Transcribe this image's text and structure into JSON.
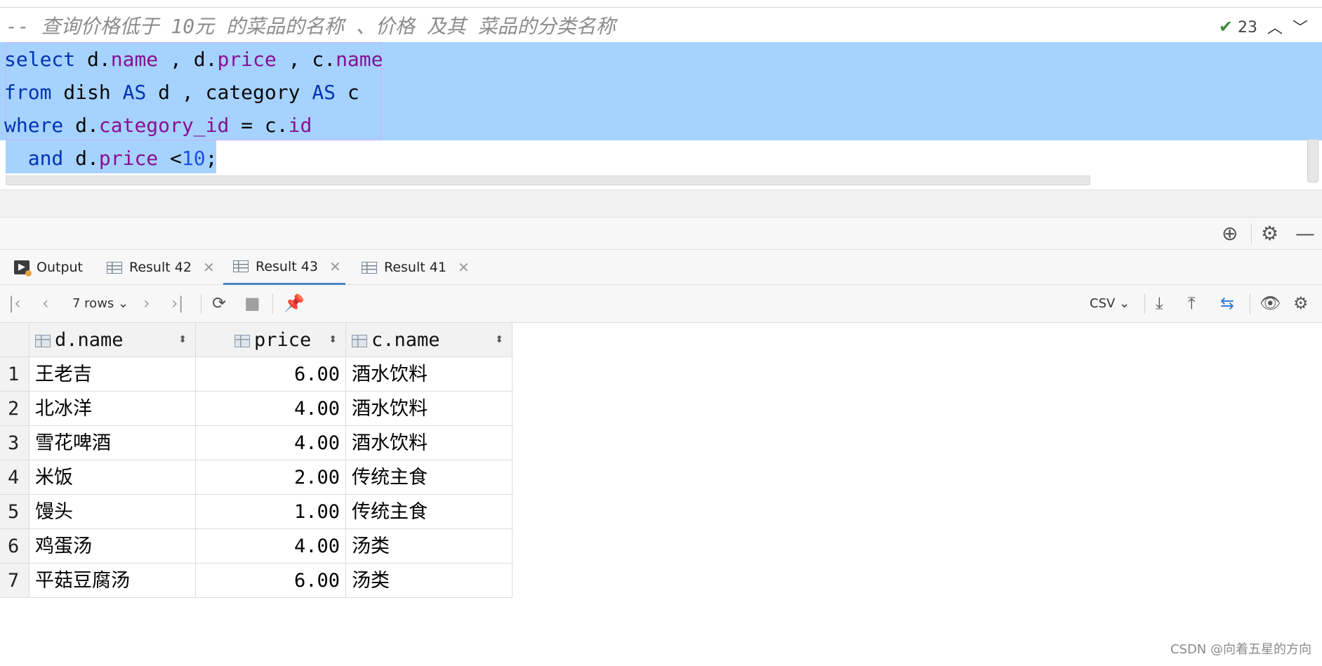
{
  "editor": {
    "comment": "-- 查询价格低于 10元 的菜品的名称 、价格 及其 菜品的分类名称",
    "inspection_count": "23",
    "line1": {
      "t1": "select",
      "t2": " d.",
      "t3": "name",
      "t4": " , d.",
      "t5": "price",
      "t6": " , c.",
      "t7": "name"
    },
    "line2": {
      "t1": "from",
      "t2": " dish ",
      "t3": "AS",
      "t4": " d , category ",
      "t5": "AS",
      "t6": " c"
    },
    "line3": {
      "t1": "where",
      "t2": " d.",
      "t3": "category_id",
      "t4": " = c.",
      "t5": "id"
    },
    "line4": {
      "t1": "  and",
      "t2": " d.",
      "t3": "price",
      "t4": " <",
      "t5": "10",
      "t6": ";"
    }
  },
  "tabs": [
    {
      "label": "Output"
    },
    {
      "label": "Result 42"
    },
    {
      "label": "Result 43"
    },
    {
      "label": "Result 41"
    }
  ],
  "toolbar": {
    "rows_label": "7 rows",
    "export_format": "CSV"
  },
  "grid": {
    "columns": [
      "d.name",
      "price",
      "c.name"
    ],
    "rows": [
      {
        "num": "1",
        "name": "王老吉",
        "price": "6.00",
        "cat": "酒水饮料"
      },
      {
        "num": "2",
        "name": "北冰洋",
        "price": "4.00",
        "cat": "酒水饮料"
      },
      {
        "num": "3",
        "name": "雪花啤酒",
        "price": "4.00",
        "cat": "酒水饮料"
      },
      {
        "num": "4",
        "name": "米饭",
        "price": "2.00",
        "cat": "传统主食"
      },
      {
        "num": "5",
        "name": "馒头",
        "price": "1.00",
        "cat": "传统主食"
      },
      {
        "num": "6",
        "name": "鸡蛋汤",
        "price": "4.00",
        "cat": "汤类"
      },
      {
        "num": "7",
        "name": "平菇豆腐汤",
        "price": "6.00",
        "cat": "汤类"
      }
    ]
  },
  "watermark": "CSDN @向着五星的方向"
}
